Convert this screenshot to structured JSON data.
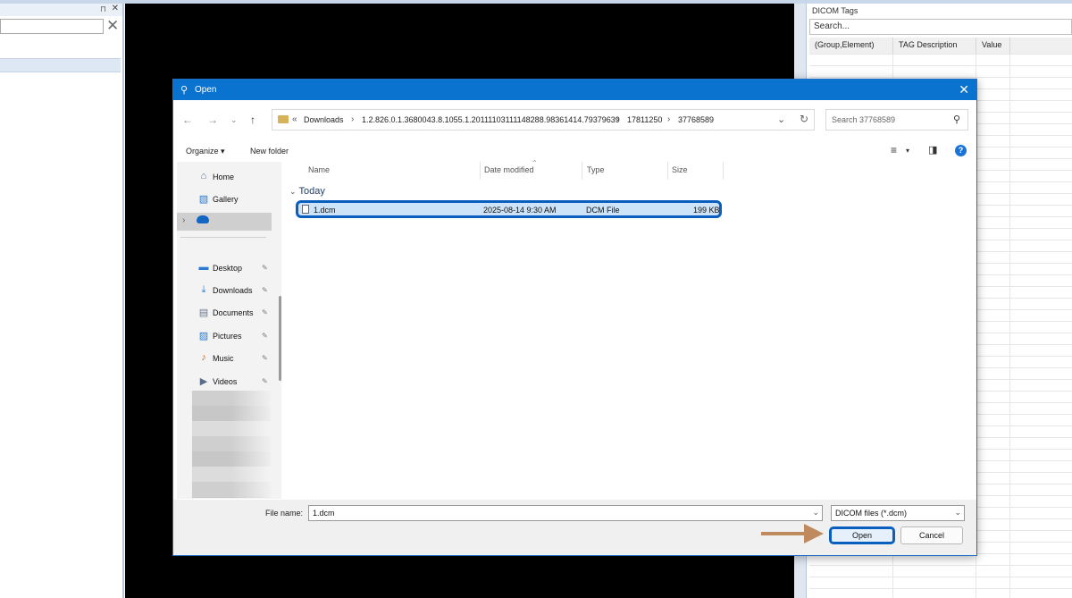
{
  "right_panel": {
    "title": "DICOM Tags",
    "search_placeholder": "Search...",
    "columns": [
      "(Group,Element)",
      "TAG Description",
      "Value"
    ]
  },
  "dialog": {
    "title": "Open",
    "breadcrumb": {
      "overflow": "«",
      "items": [
        "Downloads",
        "1.2.826.0.1.3680043.8.1055.1.20111103111148288.98361414.79379639",
        "17811250",
        "37768589"
      ]
    },
    "search_placeholder": "Search 37768589",
    "toolbar": {
      "organize": "Organize",
      "new_folder": "New folder"
    },
    "nav": [
      {
        "label": "Home",
        "icon": "home-icon",
        "glyph": "⌂"
      },
      {
        "label": "Gallery",
        "icon": "gallery-icon",
        "glyph": "▧"
      },
      {
        "label": "Desktop",
        "icon": "desktop-icon",
        "glyph": "▬"
      },
      {
        "label": "Downloads",
        "icon": "download-icon",
        "glyph": "⤓"
      },
      {
        "label": "Documents",
        "icon": "documents-icon",
        "glyph": "▤"
      },
      {
        "label": "Pictures",
        "icon": "pictures-icon",
        "glyph": "▨"
      },
      {
        "label": "Music",
        "icon": "music-icon",
        "glyph": "♪"
      },
      {
        "label": "Videos",
        "icon": "videos-icon",
        "glyph": "▶"
      }
    ],
    "columns": {
      "name": "Name",
      "date": "Date modified",
      "type": "Type",
      "size": "Size"
    },
    "group": "Today",
    "files": [
      {
        "name": "1.dcm",
        "date": "2025-08-14 9:30 AM",
        "type": "DCM File",
        "size": "199 KB"
      }
    ],
    "file_name_label": "File name:",
    "file_name_value": "1.dcm",
    "file_type": "DICOM files (*.dcm)",
    "open_label": "Open",
    "cancel_label": "Cancel"
  },
  "colors": {
    "titlebar": "#0a73cf",
    "highlight_border": "#0a5fbe",
    "selection": "#cce3f8",
    "annotation_arrow": "#bf8a5d",
    "viewer_background": "#000000"
  }
}
